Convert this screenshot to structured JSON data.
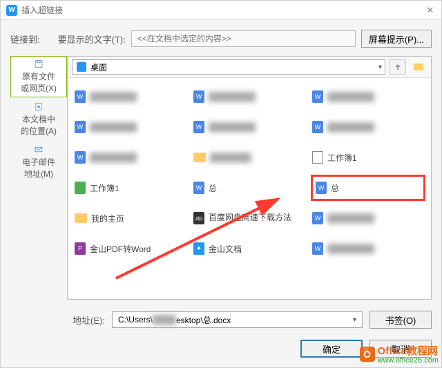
{
  "title": "插入超链接",
  "link_to_label": "链接到:",
  "display_label": "要显示的文字(T):",
  "display_placeholder": "<<在文档中选定的内容>>",
  "screen_tip_btn": "屏幕提示(P)...",
  "sidebar": {
    "items": [
      {
        "label1": "原有文件",
        "label2": "或网页(X)"
      },
      {
        "label1": "本文档中",
        "label2": "的位置(A)"
      },
      {
        "label1": "电子邮件",
        "label2": "地址(M)"
      }
    ]
  },
  "location_label": "桌面",
  "files": {
    "workbook1_txt": "工作簿1",
    "workbook1_xls": "工作簿1",
    "zong_doc": "总",
    "zong_doc2": "总",
    "homepage": "我的主页",
    "baidu": "百度网盘高速下载方法",
    "jinshan_pdf": "金山PDF转Word",
    "jinshan_doc": "金山文档"
  },
  "address_label": "地址(E):",
  "address_value_prefix": "C:\\Users\\",
  "address_value_suffix": "esktop\\总.docx",
  "bookmark_btn": "书签(O)",
  "ok_btn": "确定",
  "cancel_btn": "取消",
  "watermark": {
    "brand": "Office教程网",
    "url": "www.office26.com",
    "logo_letter": "O"
  }
}
